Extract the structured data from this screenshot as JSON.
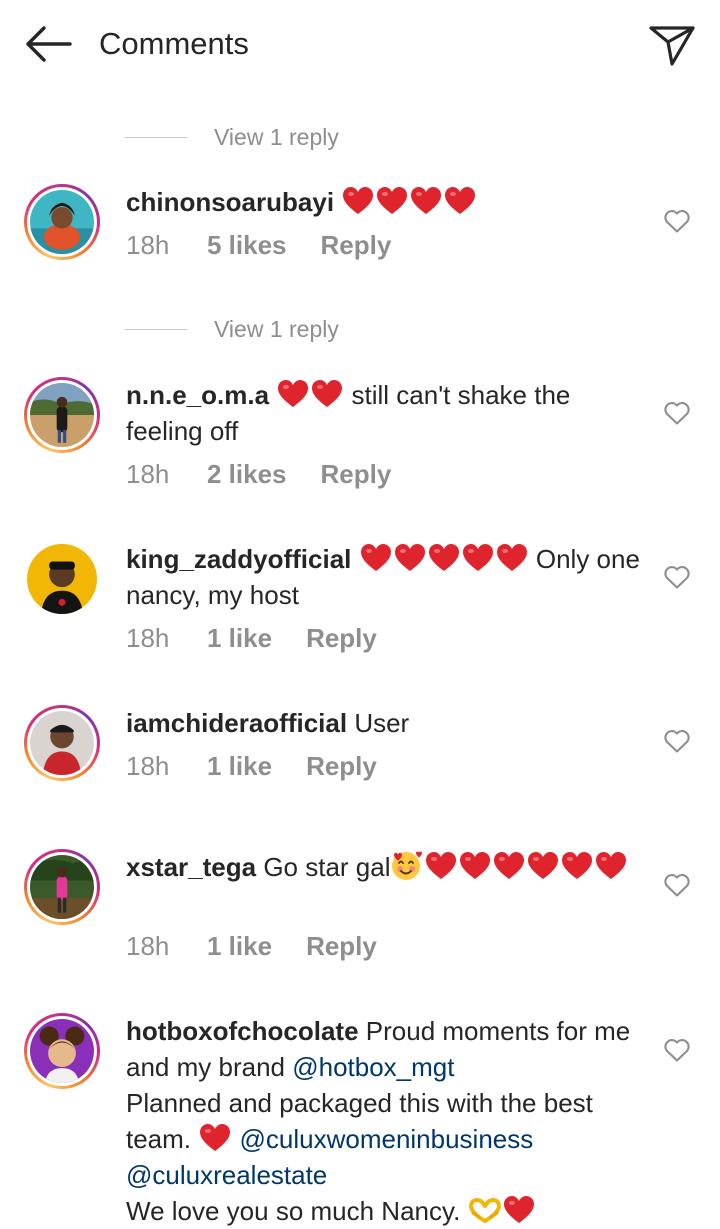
{
  "header": {
    "title": "Comments"
  },
  "view_reply_label": "View 1 reply",
  "comments": [
    {
      "username": "chinonsoarubayi",
      "text_before": "",
      "hearts": 4,
      "text_after": "",
      "time": "18h",
      "likes": "5 likes",
      "reply": "Reply"
    },
    {
      "username": "n.n.e_o.m.a",
      "hearts": 2,
      "text_after": "still can't shake the feeling off",
      "time": "18h",
      "likes": "2 likes",
      "reply": "Reply"
    },
    {
      "username": "king_zaddyofficial",
      "hearts": 5,
      "text_after": "Only one nancy, my host",
      "time": "18h",
      "likes": "1 like",
      "reply": "Reply"
    },
    {
      "username": "iamchideraofficial",
      "text": "User",
      "time": "18h",
      "likes": "1 like",
      "reply": "Reply"
    },
    {
      "username": "xstar_tega",
      "text_before": "Go star gal",
      "hearts": 6,
      "time": "18h",
      "likes": "1 like",
      "reply": "Reply"
    },
    {
      "username": "hotboxofchocolate",
      "line1": "Proud moments for me and my brand",
      "mention1": "@hotbox_mgt",
      "line2": "Planned and packaged this with the best team.",
      "mention2": "@culuxwomeninbusiness",
      "mention3": "@culuxrealestate",
      "line3": "We love you so much Nancy."
    }
  ],
  "colors": {
    "text": "#262626",
    "muted": "#8e8e8e",
    "mention": "#00376b",
    "heart": "#e0242e",
    "story_ring": "#dd2a7b"
  },
  "icons": {
    "back": "arrow-left-icon",
    "send": "paper-plane-icon",
    "like": "heart-outline-icon",
    "emoji_heart": "red-heart-emoji",
    "emoji_love_face": "smiling-face-with-hearts-emoji",
    "emoji_heart_hands": "heart-hands-emoji"
  }
}
